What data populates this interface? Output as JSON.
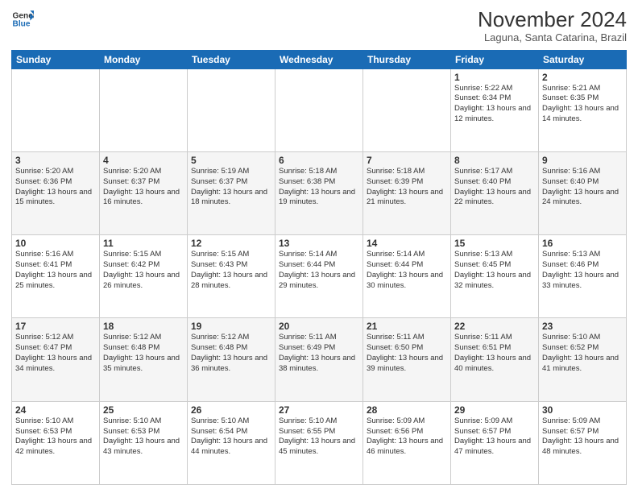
{
  "logo": {
    "line1": "General",
    "line2": "Blue"
  },
  "title": "November 2024",
  "subtitle": "Laguna, Santa Catarina, Brazil",
  "days_header": [
    "Sunday",
    "Monday",
    "Tuesday",
    "Wednesday",
    "Thursday",
    "Friday",
    "Saturday"
  ],
  "weeks": [
    [
      {
        "day": "",
        "info": ""
      },
      {
        "day": "",
        "info": ""
      },
      {
        "day": "",
        "info": ""
      },
      {
        "day": "",
        "info": ""
      },
      {
        "day": "",
        "info": ""
      },
      {
        "day": "1",
        "info": "Sunrise: 5:22 AM\nSunset: 6:34 PM\nDaylight: 13 hours and 12 minutes."
      },
      {
        "day": "2",
        "info": "Sunrise: 5:21 AM\nSunset: 6:35 PM\nDaylight: 13 hours and 14 minutes."
      }
    ],
    [
      {
        "day": "3",
        "info": "Sunrise: 5:20 AM\nSunset: 6:36 PM\nDaylight: 13 hours and 15 minutes."
      },
      {
        "day": "4",
        "info": "Sunrise: 5:20 AM\nSunset: 6:37 PM\nDaylight: 13 hours and 16 minutes."
      },
      {
        "day": "5",
        "info": "Sunrise: 5:19 AM\nSunset: 6:37 PM\nDaylight: 13 hours and 18 minutes."
      },
      {
        "day": "6",
        "info": "Sunrise: 5:18 AM\nSunset: 6:38 PM\nDaylight: 13 hours and 19 minutes."
      },
      {
        "day": "7",
        "info": "Sunrise: 5:18 AM\nSunset: 6:39 PM\nDaylight: 13 hours and 21 minutes."
      },
      {
        "day": "8",
        "info": "Sunrise: 5:17 AM\nSunset: 6:40 PM\nDaylight: 13 hours and 22 minutes."
      },
      {
        "day": "9",
        "info": "Sunrise: 5:16 AM\nSunset: 6:40 PM\nDaylight: 13 hours and 24 minutes."
      }
    ],
    [
      {
        "day": "10",
        "info": "Sunrise: 5:16 AM\nSunset: 6:41 PM\nDaylight: 13 hours and 25 minutes."
      },
      {
        "day": "11",
        "info": "Sunrise: 5:15 AM\nSunset: 6:42 PM\nDaylight: 13 hours and 26 minutes."
      },
      {
        "day": "12",
        "info": "Sunrise: 5:15 AM\nSunset: 6:43 PM\nDaylight: 13 hours and 28 minutes."
      },
      {
        "day": "13",
        "info": "Sunrise: 5:14 AM\nSunset: 6:44 PM\nDaylight: 13 hours and 29 minutes."
      },
      {
        "day": "14",
        "info": "Sunrise: 5:14 AM\nSunset: 6:44 PM\nDaylight: 13 hours and 30 minutes."
      },
      {
        "day": "15",
        "info": "Sunrise: 5:13 AM\nSunset: 6:45 PM\nDaylight: 13 hours and 32 minutes."
      },
      {
        "day": "16",
        "info": "Sunrise: 5:13 AM\nSunset: 6:46 PM\nDaylight: 13 hours and 33 minutes."
      }
    ],
    [
      {
        "day": "17",
        "info": "Sunrise: 5:12 AM\nSunset: 6:47 PM\nDaylight: 13 hours and 34 minutes."
      },
      {
        "day": "18",
        "info": "Sunrise: 5:12 AM\nSunset: 6:48 PM\nDaylight: 13 hours and 35 minutes."
      },
      {
        "day": "19",
        "info": "Sunrise: 5:12 AM\nSunset: 6:48 PM\nDaylight: 13 hours and 36 minutes."
      },
      {
        "day": "20",
        "info": "Sunrise: 5:11 AM\nSunset: 6:49 PM\nDaylight: 13 hours and 38 minutes."
      },
      {
        "day": "21",
        "info": "Sunrise: 5:11 AM\nSunset: 6:50 PM\nDaylight: 13 hours and 39 minutes."
      },
      {
        "day": "22",
        "info": "Sunrise: 5:11 AM\nSunset: 6:51 PM\nDaylight: 13 hours and 40 minutes."
      },
      {
        "day": "23",
        "info": "Sunrise: 5:10 AM\nSunset: 6:52 PM\nDaylight: 13 hours and 41 minutes."
      }
    ],
    [
      {
        "day": "24",
        "info": "Sunrise: 5:10 AM\nSunset: 6:53 PM\nDaylight: 13 hours and 42 minutes."
      },
      {
        "day": "25",
        "info": "Sunrise: 5:10 AM\nSunset: 6:53 PM\nDaylight: 13 hours and 43 minutes."
      },
      {
        "day": "26",
        "info": "Sunrise: 5:10 AM\nSunset: 6:54 PM\nDaylight: 13 hours and 44 minutes."
      },
      {
        "day": "27",
        "info": "Sunrise: 5:10 AM\nSunset: 6:55 PM\nDaylight: 13 hours and 45 minutes."
      },
      {
        "day": "28",
        "info": "Sunrise: 5:09 AM\nSunset: 6:56 PM\nDaylight: 13 hours and 46 minutes."
      },
      {
        "day": "29",
        "info": "Sunrise: 5:09 AM\nSunset: 6:57 PM\nDaylight: 13 hours and 47 minutes."
      },
      {
        "day": "30",
        "info": "Sunrise: 5:09 AM\nSunset: 6:57 PM\nDaylight: 13 hours and 48 minutes."
      }
    ]
  ]
}
